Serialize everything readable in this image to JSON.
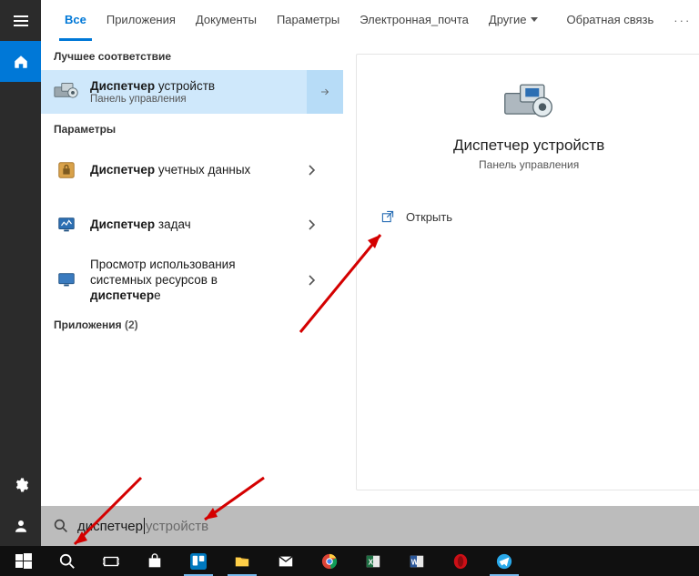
{
  "tabs": {
    "all": "Все",
    "apps": "Приложения",
    "docs": "Документы",
    "settings": "Параметры",
    "email": "Электронная_почта",
    "more": "Другие",
    "feedback": "Обратная связь"
  },
  "sections": {
    "best_match": "Лучшее соответствие",
    "settings": "Параметры",
    "apps": "Приложения",
    "apps_count": "(2)"
  },
  "results": {
    "best": {
      "title_bold": "Диспетчер",
      "title_rest": " устройств",
      "sub": "Панель управления"
    },
    "r1": {
      "title_bold": "Диспетчер",
      "title_rest": " учетных данных"
    },
    "r2": {
      "title_bold": "Диспетчер",
      "title_rest": " задач"
    },
    "r3": {
      "line1": "Просмотр использования",
      "line2a": "системных ресурсов в ",
      "line2b": "диспетчер",
      "line2c": "е"
    }
  },
  "preview": {
    "title": "Диспетчер устройств",
    "sub": "Панель управления",
    "open": "Открыть"
  },
  "search": {
    "typed": "диспетчер",
    "suggestion": " устройств"
  },
  "icons": {
    "home": "home-icon",
    "gear": "gear-icon",
    "profile": "profile-icon",
    "search": "search-icon"
  }
}
